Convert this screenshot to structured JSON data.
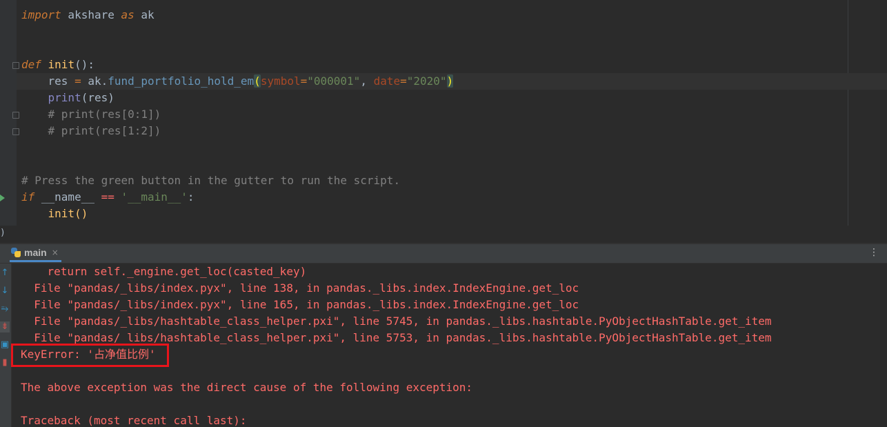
{
  "editor": {
    "lines": {
      "import": {
        "kw1": "import",
        "mod": " akshare ",
        "kw2": "as",
        "alias": " ak"
      },
      "def": {
        "kw": "def",
        "name": " init",
        "params": "():"
      },
      "res": {
        "indent": "    ",
        "var": "res",
        "eq": " = ",
        "obj": "ak.",
        "fn": "fund_portfolio_hold_em",
        "open": "(",
        "p1": "symbol",
        "e1": "=",
        "v1": "\"000001\"",
        "comma": ", ",
        "p2": "date",
        "e2": "=",
        "v2": "\"2020\"",
        "close": ")"
      },
      "print": {
        "indent": "    ",
        "fn": "print",
        "args": "(res)"
      },
      "c1": "    # print(res[0:1])",
      "c2": "    # print(res[1:2])",
      "c3": "# Press the green button in the gutter to run the script.",
      "ifmain": {
        "kw": "if",
        "name": " __name__ ",
        "op": "==",
        "sp": " ",
        "str": "'__main__'",
        "colon": ":"
      },
      "call": "    init()"
    },
    "separator_glyph": ")"
  },
  "run_panel": {
    "tab_label": "main",
    "tab_close": "×",
    "more_icon": "⋮",
    "toolbar_icons": [
      "arrow-up-icon",
      "arrow-down-icon",
      "soft-wrap-icon",
      "scroll-to-end-icon",
      "print-icon",
      "trash-icon"
    ],
    "output": [
      "    return self._engine.get_loc(casted_key)",
      "  File \"pandas/_libs/index.pyx\", line 138, in pandas._libs.index.IndexEngine.get_loc",
      "  File \"pandas/_libs/index.pyx\", line 165, in pandas._libs.index.IndexEngine.get_loc",
      "  File \"pandas/_libs/hashtable_class_helper.pxi\", line 5745, in pandas._libs.hashtable.PyObjectHashTable.get_item",
      "  File \"pandas/_libs/hashtable_class_helper.pxi\", line 5753, in pandas._libs.hashtable.PyObjectHashTable.get_item",
      "KeyError: '占净值比例'",
      "",
      "The above exception was the direct cause of the following exception:",
      "",
      "Traceback (most recent call last):"
    ]
  },
  "colors": {
    "error_text": "#ff6b68",
    "highlight_box": "#e8141b",
    "keyword": "#cc7832",
    "string": "#6a8759",
    "comment": "#808080"
  }
}
